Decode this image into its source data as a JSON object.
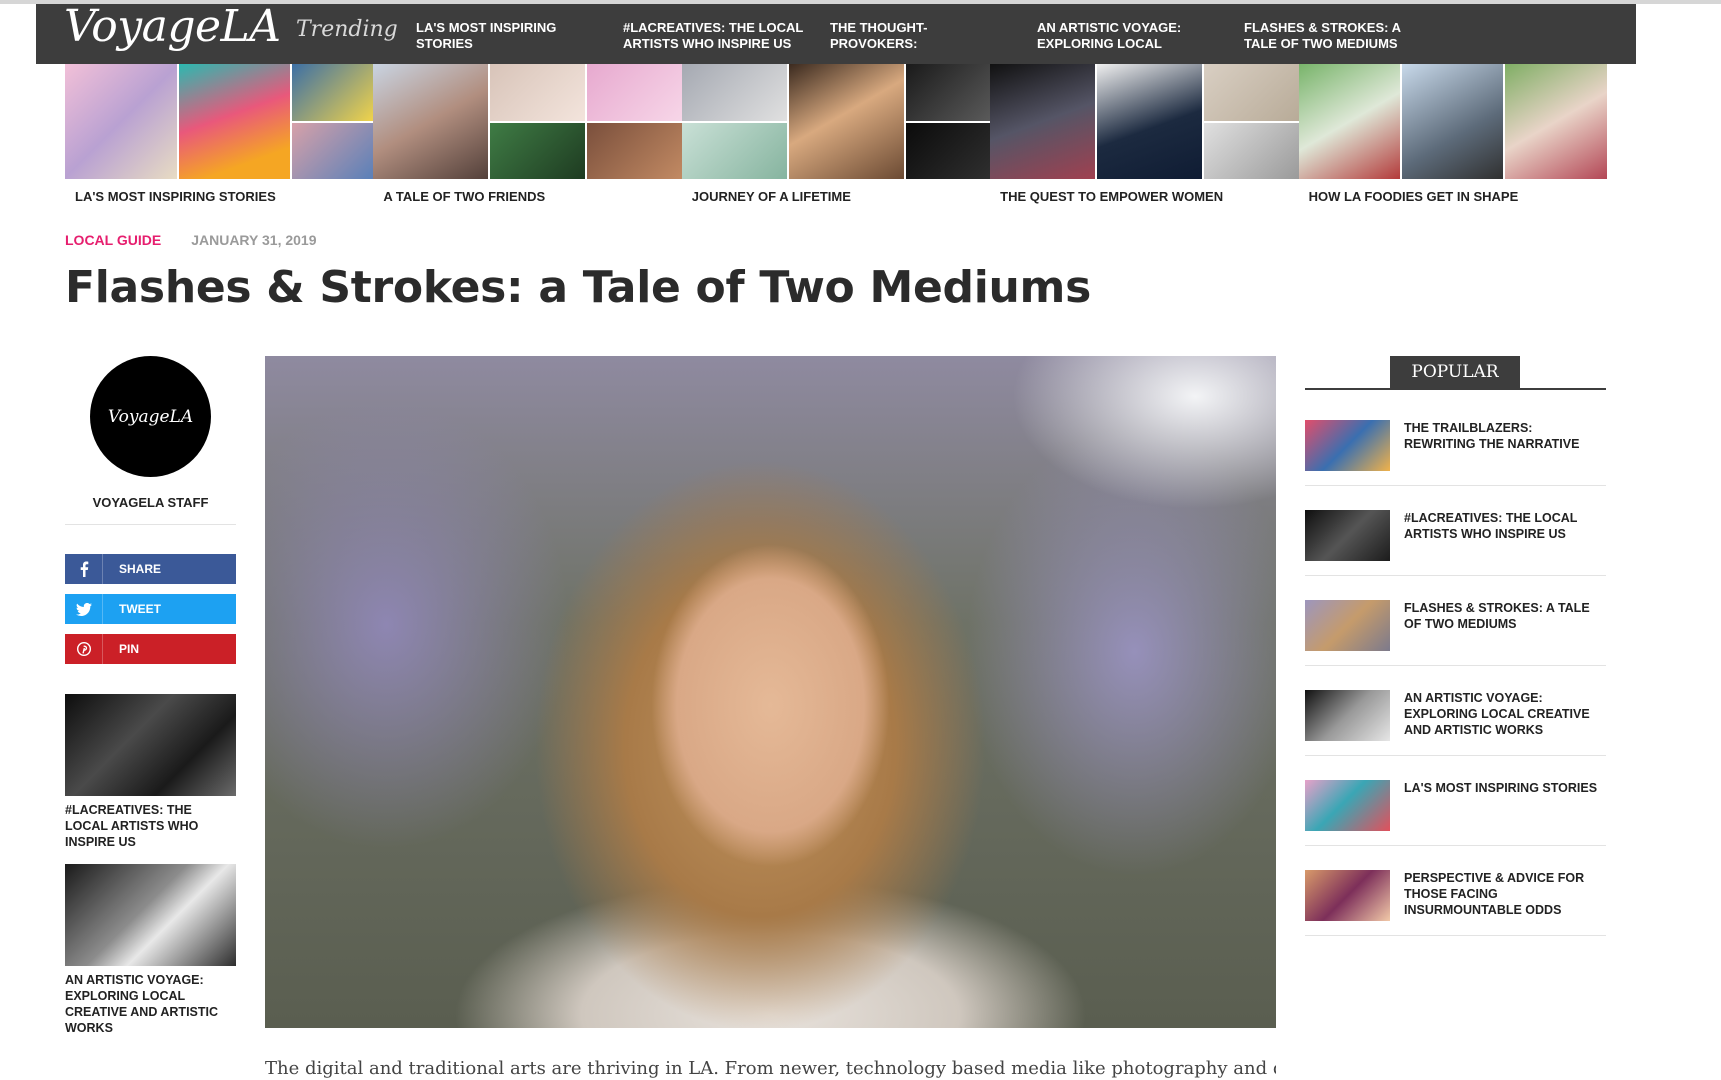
{
  "site": {
    "logo": "VoyageLA",
    "trending_label": "Trending",
    "trending": [
      "LA's MOST INSPIRING STORIES",
      "#LACREATIVES: THE LOCAL ARTISTS WHO INSPIRE US",
      "THE THOUGHT-PROVOKERS: CELEBRATING",
      "AN ARTISTIC VOYAGE: EXPLORING LOCAL",
      "FLASHES & STROKES: A TALE OF TWO MEDIUMS"
    ]
  },
  "featured": [
    {
      "title": "LA's MOST INSPIRING STORIES"
    },
    {
      "title": "A TALE OF TWO FRIENDS"
    },
    {
      "title": "JOURNEY OF A LIFETIME"
    },
    {
      "title": "THE QUEST TO EMPOWER WOMEN"
    },
    {
      "title": "HOW LA FOODIES GET IN SHAPE"
    }
  ],
  "article": {
    "category": "LOCAL GUIDE",
    "date": "JANUARY 31, 2019",
    "title": "Flashes & Strokes: a Tale of Two Mediums",
    "body_start": "The digital and traditional arts are thriving in LA. From newer, technology based media like photography and digital art to"
  },
  "author": {
    "avatar_text": "VoyageLA",
    "name": "VOYAGELA STAFF"
  },
  "share": {
    "facebook": "SHARE",
    "twitter": "TWEET",
    "pinterest": "PIN"
  },
  "related": [
    {
      "title": "#LACREATIVES: THE LOCAL ARTISTS WHO INSPIRE US"
    },
    {
      "title": "AN ARTISTIC VOYAGE: EXPLORING LOCAL CREATIVE AND ARTISTIC WORKS"
    }
  ],
  "popular": {
    "heading": "POPULAR",
    "items": [
      {
        "title": "THE TRAILBLAZERS: REWRITING THE NARRATIVE"
      },
      {
        "title": "#LACREATIVES: THE LOCAL ARTISTS WHO INSPIRE US"
      },
      {
        "title": "FLASHES & STROKES: A TALE OF TWO MEDIUMS"
      },
      {
        "title": "AN ARTISTIC VOYAGE: EXPLORING LOCAL CREATIVE AND ARTISTIC WORKS"
      },
      {
        "title": "LA's MOST INSPIRING STORIES"
      },
      {
        "title": "PERSPECTIVE & ADVICE FOR THOSE FACING INSURMOUNTABLE ODDS"
      }
    ]
  },
  "colors": {
    "nav_bg": "#3d3d3d",
    "category_accent": "#e61e6e",
    "facebook": "#3b5998",
    "twitter": "#1da1f2",
    "pinterest": "#cb2027"
  },
  "icons": {
    "facebook": "facebook-icon",
    "twitter": "twitter-icon",
    "pinterest": "pinterest-icon"
  }
}
